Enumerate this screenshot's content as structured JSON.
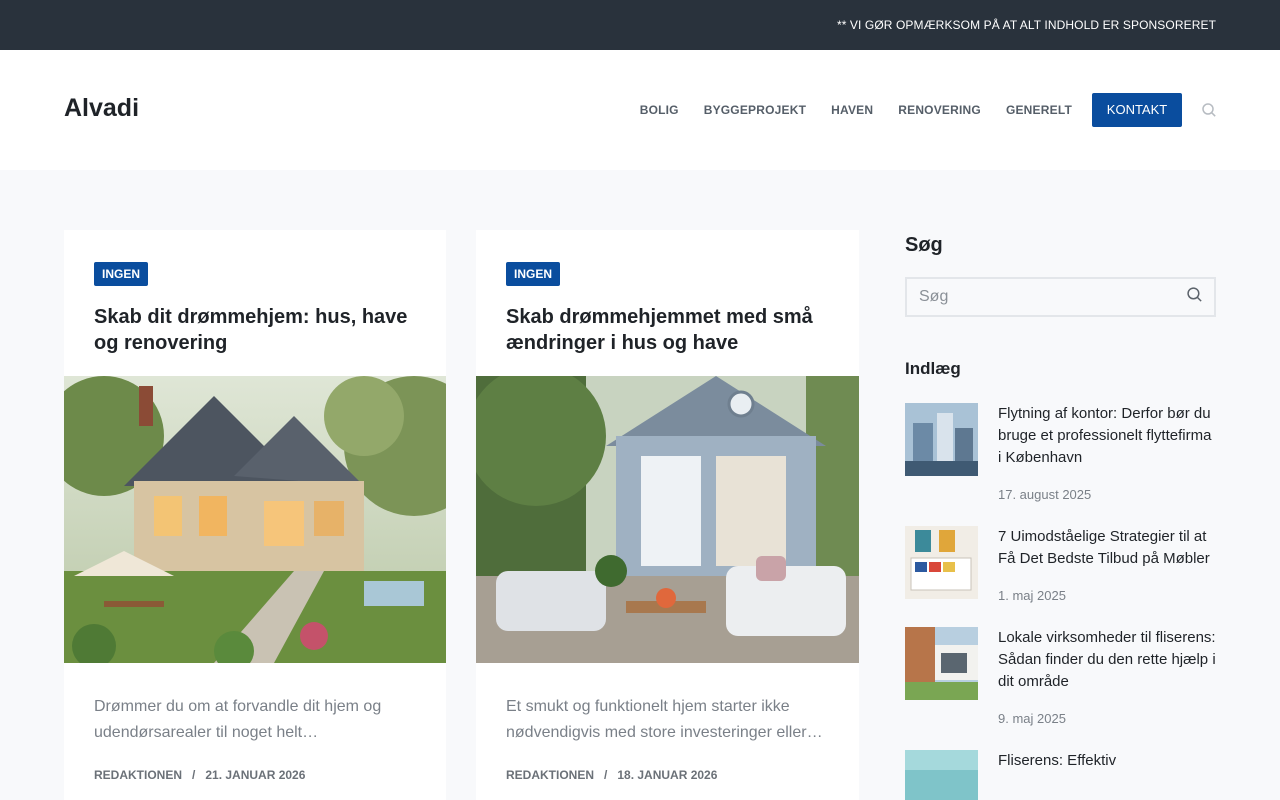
{
  "notice": "** VI GØR OPMÆRKSOM PÅ AT ALT INDHOLD ER SPONSORERET",
  "site": {
    "logo": "Alvadi"
  },
  "nav": {
    "items": [
      "BOLIG",
      "BYGGEPROJEKT",
      "HAVEN",
      "RENOVERING",
      "GENERELT"
    ],
    "contact": "KONTAKT"
  },
  "articles": [
    {
      "badge": "INGEN",
      "title": "Skab dit drømmehjem: hus, have og renovering",
      "excerpt": "Drømmer du om at forvandle dit hjem og udendørsarealer til noget helt…",
      "author": "REDAKTIONEN",
      "date": "21. JANUAR 2026"
    },
    {
      "badge": "INGEN",
      "title": "Skab drømmehjemmet med små ændringer i hus og have",
      "excerpt": "Et smukt og funktionelt hjem starter ikke nødvendigvis med store investeringer eller…",
      "author": "REDAKTIONEN",
      "date": "18. JANUAR 2026"
    }
  ],
  "sidebar": {
    "search_heading": "Søg",
    "search_placeholder": "Søg",
    "posts_heading": "Indlæg",
    "posts": [
      {
        "title": "Flytning af kontor: Derfor bør du bruge et professionelt flyttefirma i København",
        "date": "17. august 2025"
      },
      {
        "title": "7 Uimodståelige Strategier til at Få Det Bedste Tilbud på Møbler",
        "date": "1. maj 2025"
      },
      {
        "title": "Lokale virksomheder til fliserens: Sådan finder du den rette hjælp i dit område",
        "date": "9. maj 2025"
      },
      {
        "title": "Fliserens: Effektiv",
        "date": ""
      }
    ]
  },
  "colors": {
    "accent": "#0a4d9e",
    "topbar": "#29323c",
    "page_bg": "#f8f9fb"
  }
}
